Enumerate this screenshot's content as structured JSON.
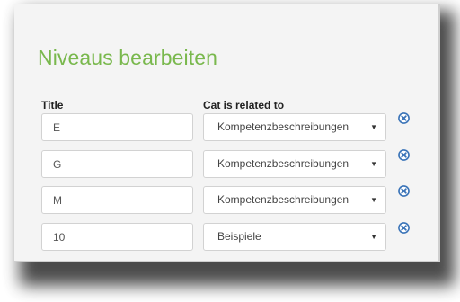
{
  "dialog": {
    "title": "Niveaus bearbeiten",
    "columns": {
      "title": "Title",
      "category": "Cat is related to"
    },
    "rows": [
      {
        "title": "E",
        "category": "Kompetenzbeschreibungen"
      },
      {
        "title": "G",
        "category": "Kompetenzbeschreibungen"
      },
      {
        "title": "M",
        "category": "Kompetenzbeschreibungen"
      },
      {
        "title": "10",
        "category": "Beispiele"
      }
    ],
    "delete_icon": "circle-x-icon",
    "dropdown_icon": "triangle-down-icon"
  },
  "colors": {
    "title": "#79b84d",
    "delete_icon": "#3b74b8",
    "dialog_bg": "#f4f4f4"
  }
}
